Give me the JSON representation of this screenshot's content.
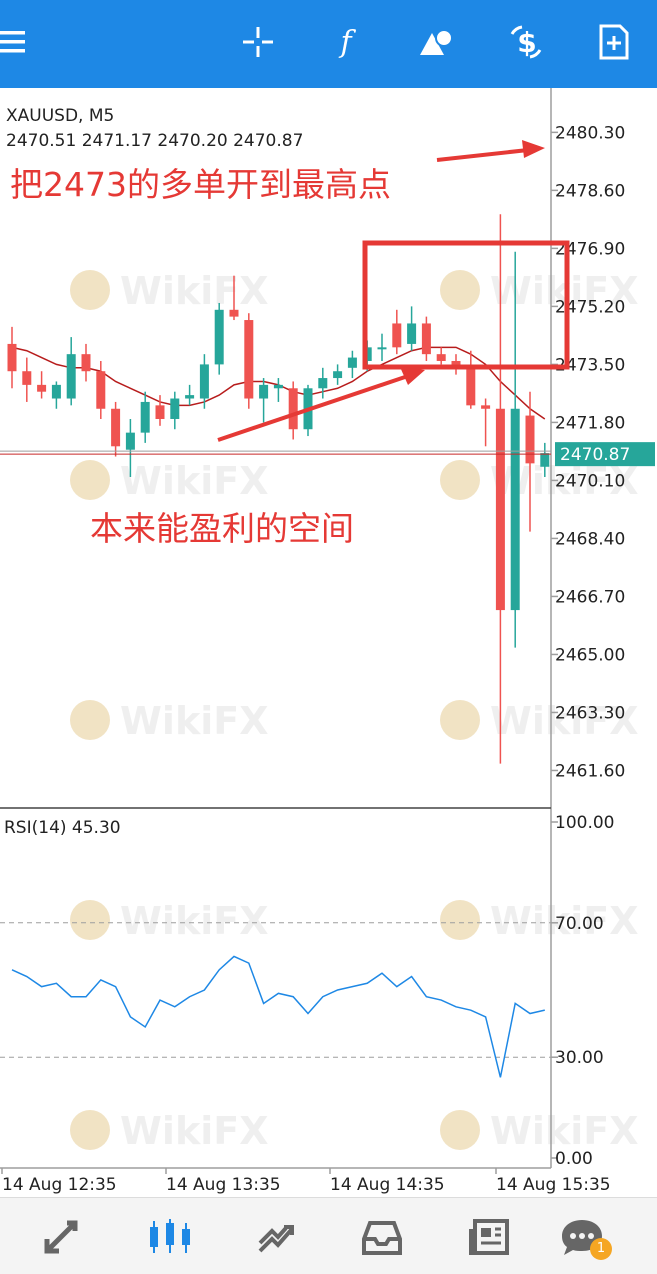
{
  "toolbar": {
    "icons": [
      "menu-icon",
      "crosshair-icon",
      "function-icon",
      "objects-icon",
      "symbol-icon",
      "new-order-icon"
    ],
    "background_color": "#1e88e5"
  },
  "chart_info": {
    "symbol": "XAUUSD, M5",
    "ohlc": "2470.51 2471.17 2470.20 2470.87",
    "current_price": "2470.87"
  },
  "annotations": {
    "top_text": "把2473的多单开到最高点",
    "middle_text": "本来能盈利的空间",
    "color": "#e53935"
  },
  "rsi": {
    "label": "RSI(14) 45.30",
    "ticks": [
      "100.00",
      "70.00",
      "30.00",
      "0.00"
    ]
  },
  "bottom_nav": {
    "items": [
      "quotes-icon",
      "chart-icon",
      "trade-icon",
      "history-icon",
      "news-icon",
      "messages-icon"
    ],
    "badge": "1"
  },
  "watermark": "WikiFX",
  "chart_data": [
    {
      "type": "candlestick",
      "title": "XAUUSD, M5",
      "y_ticks": [
        "2480.30",
        "2478.60",
        "2476.90",
        "2475.20",
        "2473.50",
        "2471.80",
        "2470.10",
        "2468.40",
        "2466.70",
        "2465.00",
        "2463.30",
        "2461.60"
      ],
      "x_ticks": [
        "14 Aug 12:35",
        "14 Aug 13:35",
        "14 Aug 14:35",
        "14 Aug 15:35"
      ],
      "ylim": [
        2460.5,
        2481.6
      ],
      "candles": [
        {
          "o": 2474.1,
          "h": 2474.6,
          "l": 2472.8,
          "c": 2473.3
        },
        {
          "o": 2473.3,
          "h": 2473.7,
          "l": 2472.4,
          "c": 2472.9
        },
        {
          "o": 2472.9,
          "h": 2473.3,
          "l": 2472.5,
          "c": 2472.7
        },
        {
          "o": 2472.5,
          "h": 2473.0,
          "l": 2472.2,
          "c": 2472.9
        },
        {
          "o": 2472.5,
          "h": 2474.3,
          "l": 2472.3,
          "c": 2473.8
        },
        {
          "o": 2473.8,
          "h": 2474.1,
          "l": 2473.0,
          "c": 2473.3
        },
        {
          "o": 2473.3,
          "h": 2473.6,
          "l": 2471.9,
          "c": 2472.2
        },
        {
          "o": 2472.2,
          "h": 2472.4,
          "l": 2470.8,
          "c": 2471.1
        },
        {
          "o": 2471.0,
          "h": 2471.9,
          "l": 2470.2,
          "c": 2471.5
        },
        {
          "o": 2471.5,
          "h": 2472.7,
          "l": 2471.2,
          "c": 2472.4
        },
        {
          "o": 2472.3,
          "h": 2472.6,
          "l": 2471.7,
          "c": 2471.9
        },
        {
          "o": 2471.9,
          "h": 2472.7,
          "l": 2471.6,
          "c": 2472.5
        },
        {
          "o": 2472.5,
          "h": 2472.9,
          "l": 2472.3,
          "c": 2472.6
        },
        {
          "o": 2472.5,
          "h": 2473.8,
          "l": 2472.2,
          "c": 2473.5
        },
        {
          "o": 2473.5,
          "h": 2475.3,
          "l": 2473.2,
          "c": 2475.1
        },
        {
          "o": 2475.1,
          "h": 2476.1,
          "l": 2474.8,
          "c": 2474.9
        },
        {
          "o": 2474.8,
          "h": 2475.0,
          "l": 2472.2,
          "c": 2472.5
        },
        {
          "o": 2472.5,
          "h": 2473.1,
          "l": 2471.8,
          "c": 2472.9
        },
        {
          "o": 2472.8,
          "h": 2473.1,
          "l": 2472.4,
          "c": 2472.9
        },
        {
          "o": 2472.8,
          "h": 2473.0,
          "l": 2471.3,
          "c": 2471.6
        },
        {
          "o": 2471.6,
          "h": 2472.9,
          "l": 2471.4,
          "c": 2472.8
        },
        {
          "o": 2472.8,
          "h": 2473.4,
          "l": 2472.5,
          "c": 2473.1
        },
        {
          "o": 2473.1,
          "h": 2473.5,
          "l": 2472.9,
          "c": 2473.3
        },
        {
          "o": 2473.4,
          "h": 2473.9,
          "l": 2473.1,
          "c": 2473.7
        },
        {
          "o": 2473.6,
          "h": 2474.2,
          "l": 2473.3,
          "c": 2474.0
        },
        {
          "o": 2474.0,
          "h": 2474.4,
          "l": 2473.6,
          "c": 2474.0
        },
        {
          "o": 2474.7,
          "h": 2475.1,
          "l": 2473.8,
          "c": 2474.0
        },
        {
          "o": 2474.1,
          "h": 2475.2,
          "l": 2473.9,
          "c": 2474.7
        },
        {
          "o": 2474.7,
          "h": 2474.9,
          "l": 2473.6,
          "c": 2473.8
        },
        {
          "o": 2473.8,
          "h": 2474.0,
          "l": 2473.5,
          "c": 2473.6
        },
        {
          "o": 2473.6,
          "h": 2473.8,
          "l": 2473.2,
          "c": 2473.4
        },
        {
          "o": 2473.4,
          "h": 2473.9,
          "l": 2472.2,
          "c": 2472.3
        },
        {
          "o": 2472.3,
          "h": 2472.5,
          "l": 2471.1,
          "c": 2472.2
        },
        {
          "o": 2472.2,
          "h": 2477.9,
          "l": 2461.8,
          "c": 2466.3
        },
        {
          "o": 2466.3,
          "h": 2476.8,
          "l": 2465.2,
          "c": 2472.2
        },
        {
          "o": 2472.0,
          "h": 2472.7,
          "l": 2468.6,
          "c": 2470.6
        },
        {
          "o": 2470.5,
          "h": 2471.2,
          "l": 2470.2,
          "c": 2470.9
        }
      ],
      "moving_average": [
        2474.0,
        2473.9,
        2473.7,
        2473.5,
        2473.4,
        2473.4,
        2473.3,
        2473.0,
        2472.8,
        2472.6,
        2472.4,
        2472.3,
        2472.3,
        2472.4,
        2472.6,
        2472.9,
        2473.0,
        2473.0,
        2472.9,
        2472.7,
        2472.6,
        2472.7,
        2472.8,
        2473.0,
        2473.3,
        2473.5,
        2473.7,
        2473.9,
        2474.0,
        2474.0,
        2474.0,
        2473.8,
        2473.5,
        2473.0,
        2472.6,
        2472.2,
        2471.9
      ]
    },
    {
      "type": "line",
      "title": "RSI(14) 45.30",
      "ylim": [
        0,
        100
      ],
      "y_ticks": [
        "100.00",
        "70.00",
        "30.00",
        "0.00"
      ],
      "values": [
        56,
        54,
        51,
        52,
        48,
        48,
        53,
        51,
        42,
        39,
        47,
        45,
        48,
        50,
        56,
        60,
        58,
        46,
        49,
        48,
        43,
        48,
        50,
        51,
        52,
        55,
        51,
        54,
        48,
        47,
        45,
        44,
        42,
        24,
        46,
        43,
        44
      ]
    }
  ]
}
